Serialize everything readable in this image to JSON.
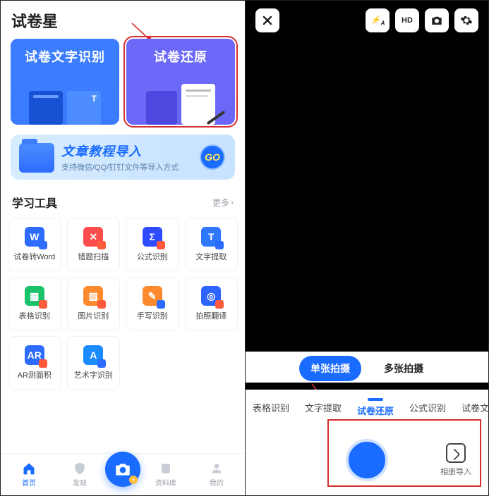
{
  "app_name": "试卷星",
  "hero_cards": [
    {
      "label": "试卷文字识别"
    },
    {
      "label": "试卷还原"
    }
  ],
  "banner": {
    "title": "文章教程导入",
    "subtitle": "支持微信/QQ/钉钉文件等导入方式",
    "go": "GO"
  },
  "tools_section": {
    "title": "学习工具",
    "more": "更多"
  },
  "tools": [
    {
      "label": "试卷转Word",
      "cls": "t-blue",
      "glyph": "W"
    },
    {
      "label": "错题扫描",
      "cls": "t-red",
      "glyph": "✕"
    },
    {
      "label": "公式识别",
      "cls": "t-indigo",
      "glyph": "Σ"
    },
    {
      "label": "文字提取",
      "cls": "t-tblue",
      "glyph": "T"
    },
    {
      "label": "表格识别",
      "cls": "t-green",
      "glyph": "▦"
    },
    {
      "label": "图片识别",
      "cls": "t-orange",
      "glyph": "▧"
    },
    {
      "label": "手写识别",
      "cls": "t-orange",
      "glyph": "✎"
    },
    {
      "label": "拍照翻译",
      "cls": "t-deepblue",
      "glyph": "◎"
    },
    {
      "label": "AR测面积",
      "cls": "t-alblue",
      "glyph": "AR"
    },
    {
      "label": "艺术字识别",
      "cls": "t-sky",
      "glyph": "A"
    }
  ],
  "nav": [
    {
      "label": "首页",
      "active": true
    },
    {
      "label": "发现",
      "active": false
    },
    {
      "label": "",
      "active": false
    },
    {
      "label": "资料库",
      "active": false
    },
    {
      "label": "我的",
      "active": false
    }
  ],
  "camera": {
    "top_buttons": [
      "⚡A",
      "HD",
      "📷",
      "⚙"
    ],
    "modes": [
      {
        "label": "单张拍摄",
        "pill": true
      },
      {
        "label": "多张拍摄",
        "pill": false
      }
    ],
    "categories": [
      {
        "label": "表格识别",
        "active": false
      },
      {
        "label": "文字提取",
        "active": false
      },
      {
        "label": "试卷还原",
        "active": true
      },
      {
        "label": "公式识别",
        "active": false
      },
      {
        "label": "试卷文字识",
        "active": false
      }
    ],
    "album_label": "相册导入"
  },
  "colors": {
    "accent": "#1a6bff",
    "highlight": "#d62f2f"
  }
}
